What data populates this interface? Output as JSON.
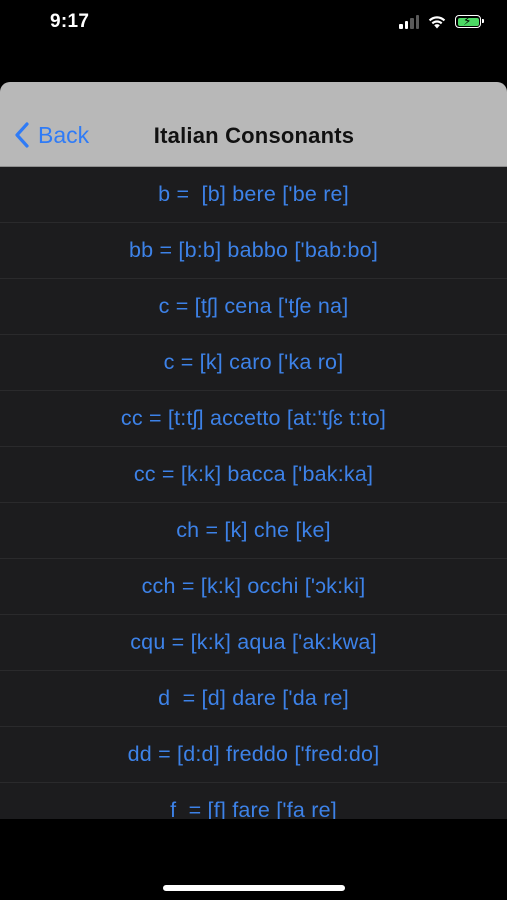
{
  "status_bar": {
    "time": "9:17"
  },
  "nav": {
    "back_label": "Back",
    "title": "Italian Consonants"
  },
  "rows": [
    "b =  [b] bere ['be re]",
    "bb = [b:b] babbo ['bab:bo]",
    "c = [tʃ] cena ['tʃe na]",
    "c = [k] caro ['ka ro]",
    "cc = [t:tʃ] accetto [at:'tʃɛ t:to]",
    "cc = [k:k] bacca ['bak:ka]",
    "ch = [k] che [ke]",
    "cch = [k:k] occhi ['ɔk:ki]",
    "cqu = [k:k] aqua ['ak:kwa]",
    "d  = [d] dare ['da re]",
    "dd = [d:d] freddo ['fred:do]",
    "f  = [f] fare ['fa re]"
  ],
  "colors": {
    "accent": "#3d82e8",
    "nav_background": "#b8b8b8",
    "list_background": "#1c1c1e",
    "battery_fill": "#4cd964"
  },
  "icons": {
    "signal": "cellular-signal-icon",
    "wifi": "wifi-icon",
    "battery": "battery-charging-icon",
    "back": "chevron-left-icon"
  }
}
